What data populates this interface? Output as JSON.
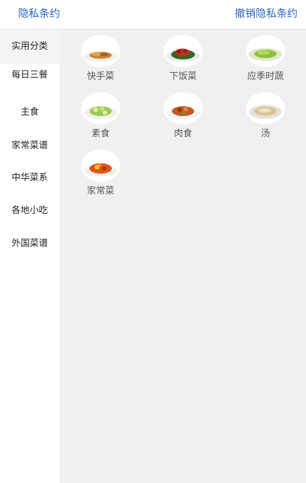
{
  "header": {
    "privacy_label": "隐私条约",
    "revoke_label": "撤销隐私条约"
  },
  "sidebar": {
    "items": [
      {
        "label": "实用分类",
        "active": true
      },
      {
        "label": "每日三餐"
      },
      {
        "label": "主食"
      },
      {
        "label": "家常菜谱"
      },
      {
        "label": "中华菜系"
      },
      {
        "label": "各地小吃"
      },
      {
        "label": "外国菜谱"
      }
    ]
  },
  "categories": [
    {
      "label": "快手菜"
    },
    {
      "label": "下饭菜"
    },
    {
      "label": "应季时蔬"
    },
    {
      "label": "素食"
    },
    {
      "label": "肉食"
    },
    {
      "label": "汤"
    },
    {
      "label": "家常菜"
    }
  ],
  "colors": {
    "link": "#2a66c2",
    "background": "#efefef"
  }
}
